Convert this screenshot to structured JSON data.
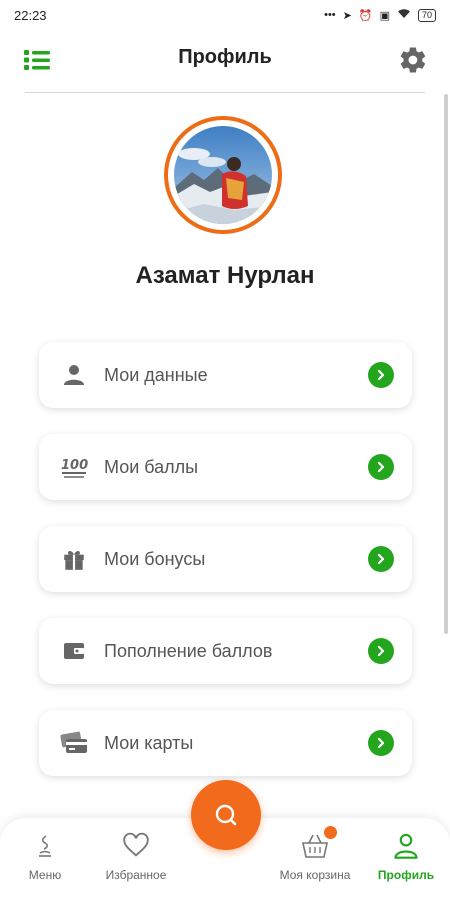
{
  "status_bar": {
    "time": "22:23",
    "battery": "70"
  },
  "header": {
    "title": "Профиль"
  },
  "profile": {
    "name": "Азамат Нурлан"
  },
  "menu": [
    {
      "label": "Мои данные",
      "icon": "user-icon"
    },
    {
      "label": "Мои баллы",
      "icon": "points-100-icon"
    },
    {
      "label": "Мои бонусы",
      "icon": "gift-icon"
    },
    {
      "label": "Пополнение баллов",
      "icon": "wallet-icon"
    },
    {
      "label": "Мои карты",
      "icon": "cards-icon"
    }
  ],
  "bottom_nav": {
    "items": [
      {
        "label": "Меню",
        "icon": "menu-dish-icon",
        "active": false
      },
      {
        "label": "Избранное",
        "icon": "heart-icon",
        "active": false
      },
      {
        "label": "Моя корзина",
        "icon": "basket-icon",
        "active": false
      },
      {
        "label": "Профиль",
        "icon": "profile-icon",
        "active": true
      }
    ]
  },
  "colors": {
    "accent_green": "#23a51e",
    "accent_orange": "#f26a1b"
  }
}
